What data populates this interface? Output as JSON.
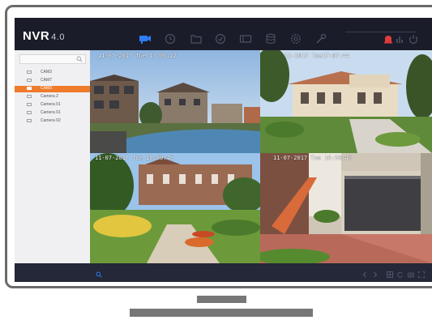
{
  "app": {
    "name": "NVR",
    "version": "4.0"
  },
  "nav_icons": [
    "camera-live-icon",
    "playback-icon",
    "file-folder-icon",
    "smart-icon",
    "vca-icon",
    "storage-icon",
    "configuration-icon",
    "maintenance-icon",
    "alarm-icon",
    "statistics-icon",
    "power-icon"
  ],
  "sidebar": {
    "cameras": [
      {
        "label": "CAM3",
        "active": false
      },
      {
        "label": "CAM7",
        "active": false
      },
      {
        "label": "CAM3",
        "active": true
      },
      {
        "label": "Camera 2",
        "active": false
      },
      {
        "label": "Camera 01",
        "active": false
      },
      {
        "label": "Camera 01",
        "active": false
      },
      {
        "label": "Camera 02",
        "active": false
      }
    ]
  },
  "tiles": [
    {
      "timestamp": "11-07-2017 Tue 17:06:22"
    },
    {
      "timestamp": "11-2017 Tue17:07:44"
    },
    {
      "timestamp": "11-07-2017 Tue 16:59:49"
    },
    {
      "timestamp": "11-07-2017 Tue 16:59:49"
    }
  ],
  "bottom_icons": [
    "search-icon",
    "prev-icon",
    "next-icon",
    "grid-layout-icon",
    "refresh-icon",
    "snapshot-icon",
    "fullscreen-icon"
  ],
  "colors": {
    "accent": "#f07b2a",
    "active_nav": "#2f7df6",
    "alarm": "#e23b3b",
    "screen_bg": "#1c1e2a"
  }
}
